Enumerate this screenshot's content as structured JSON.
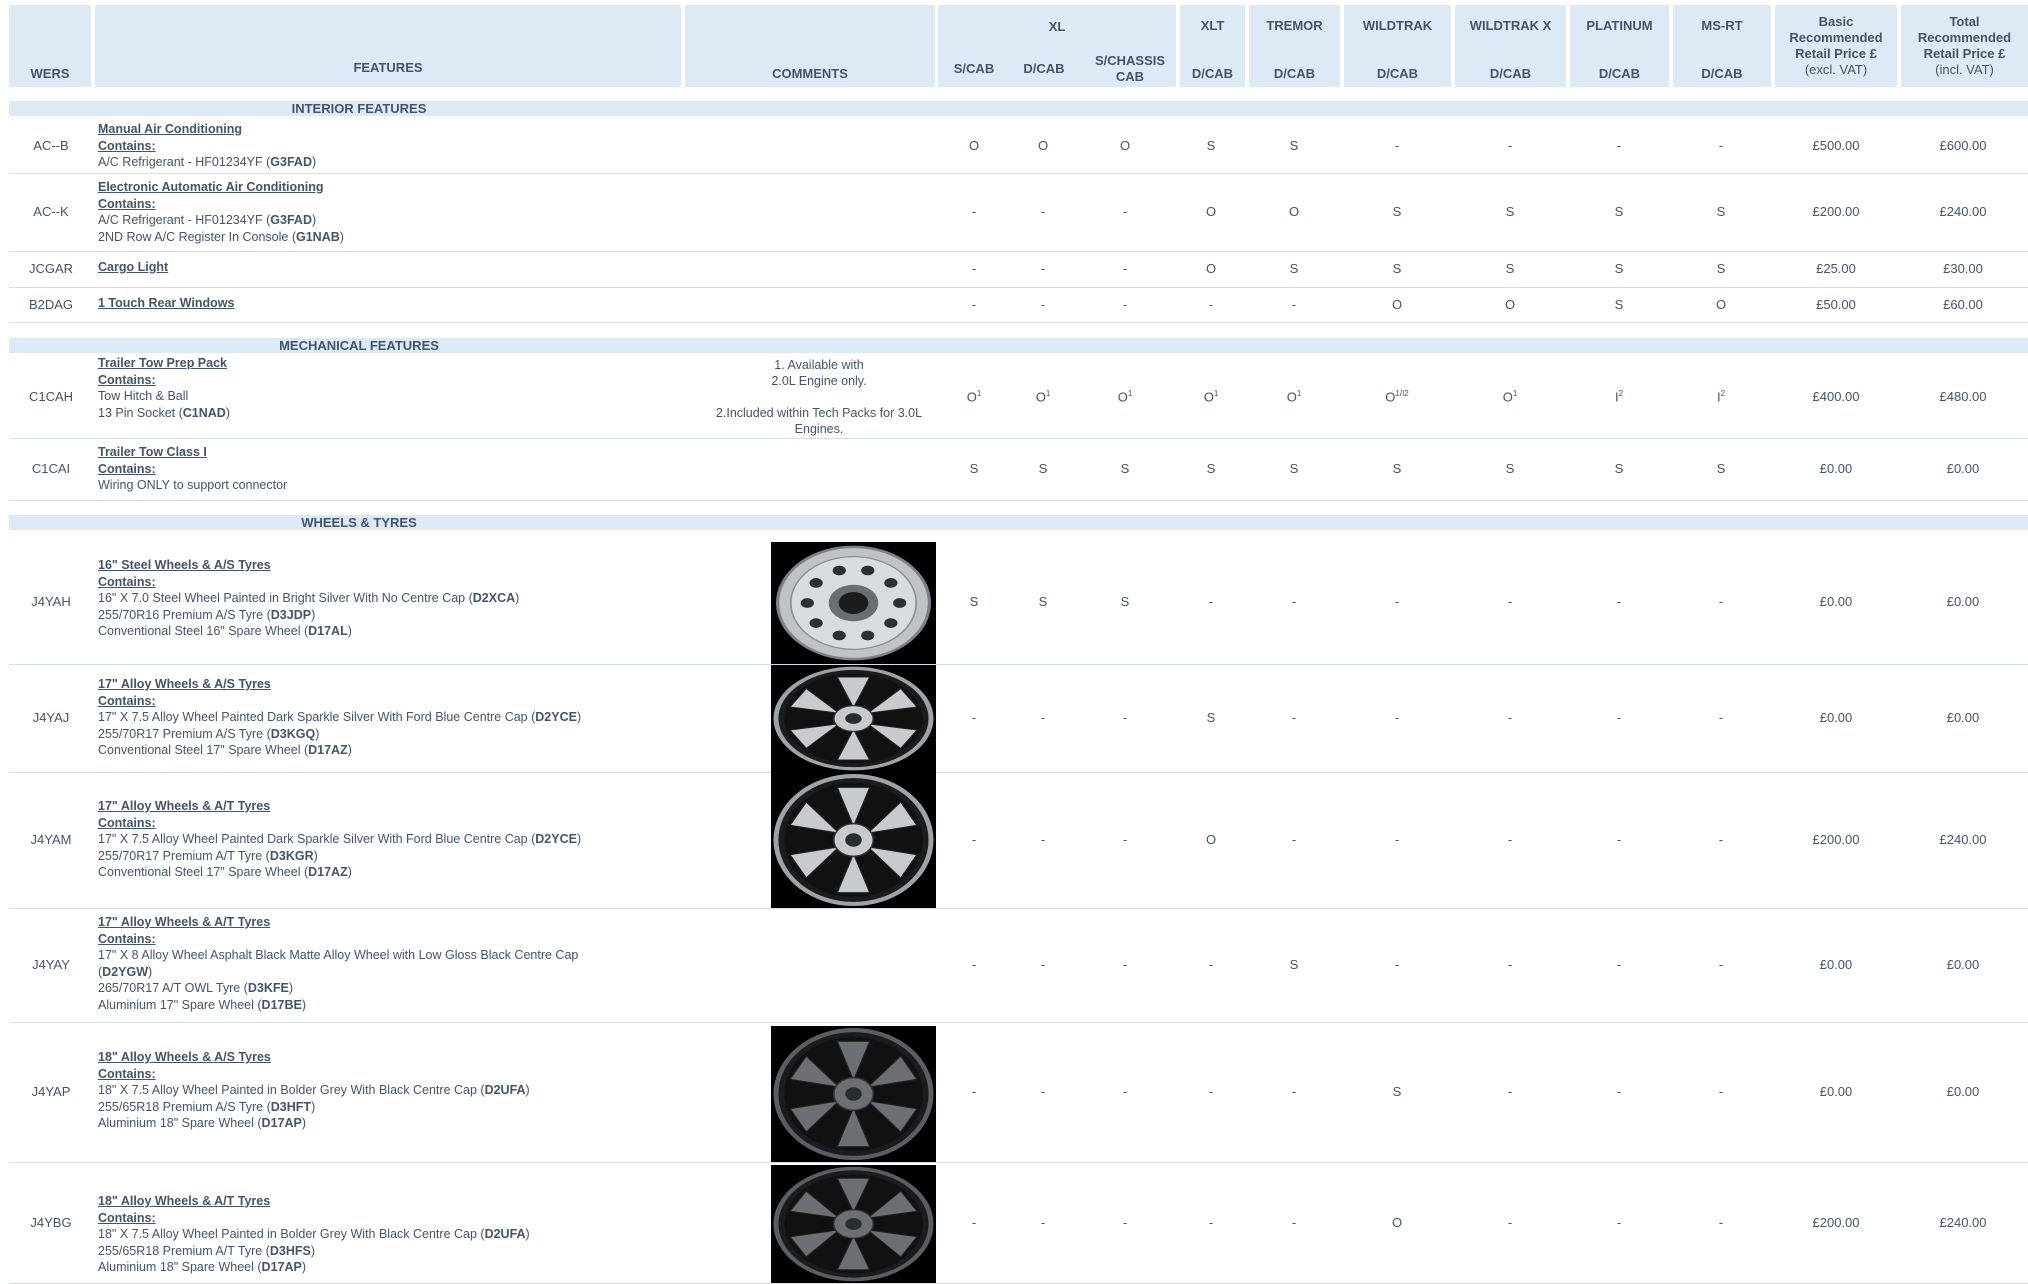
{
  "header": {
    "wers": "WERS",
    "features": "FEATURES",
    "comments": "COMMENTS",
    "xl": "XL",
    "xl_scab": "S/CAB",
    "xl_dcab": "D/CAB",
    "xl_schassis": "S/CHASSIS CAB",
    "xlt": "XLT",
    "tremor": "TREMOR",
    "wildtrak": "WILDTRAK",
    "wildtrakx": "WILDTRAK X",
    "platinum": "PLATINUM",
    "msrt": "MS-RT",
    "dcab": "D/CAB",
    "basic_title": "Basic Recommended Retail Price £",
    "basic_sub": "(excl. VAT)",
    "total_title": "Total Recommended Retail Price £",
    "total_sub": "(incl. VAT)"
  },
  "sections": {
    "interior": "INTERIOR FEATURES",
    "mechanical": "MECHANICAL FEATURES",
    "wheels": "WHEELS & TYRES"
  },
  "rows": [
    {
      "wers": "AC--B",
      "title": "Manual Air Conditioning",
      "contains": "Contains:",
      "lines": [
        [
          "A/C Refrigerant - HF01234YF (",
          "G3FAD",
          ")"
        ]
      ],
      "cells": [
        "O",
        "O",
        "O",
        "S",
        "S",
        "-",
        "-",
        "-",
        "-"
      ],
      "basic": "£500.00",
      "total": "£600.00"
    },
    {
      "wers": "AC--K",
      "title": "Electronic Automatic Air Conditioning",
      "contains": "Contains:",
      "lines": [
        [
          "A/C Refrigerant - HF01234YF (",
          "G3FAD",
          ")"
        ],
        [
          "2ND Row A/C Register In Console (",
          "G1NAB",
          ")"
        ]
      ],
      "cells": [
        "-",
        "-",
        "-",
        "O",
        "O",
        "S",
        "S",
        "S",
        "S"
      ],
      "basic": "£200.00",
      "total": "£240.00"
    },
    {
      "wers": "JCGAR",
      "title": "Cargo Light",
      "contains": "",
      "lines": [],
      "cells": [
        "-",
        "-",
        "-",
        "O",
        "S",
        "S",
        "S",
        "S",
        "S"
      ],
      "basic": "£25.00",
      "total": "£30.00"
    },
    {
      "wers": "B2DAG",
      "title": "1 Touch Rear Windows",
      "contains": "",
      "lines": [],
      "cells": [
        "-",
        "-",
        "-",
        "-",
        "-",
        "O",
        "O",
        "S",
        "O"
      ],
      "basic": "£50.00",
      "total": "£60.00"
    },
    {
      "wers": "C1CAH",
      "title": "Trailer Tow Prep Pack",
      "contains": "Contains:",
      "lines": [
        [
          "Tow Hitch & Ball",
          "",
          ""
        ],
        [
          "13 Pin Socket (",
          "C1NAD",
          ")"
        ]
      ],
      "comment1": "1. Available with",
      "comment2": "2.0L Engine only.",
      "comment3": "2.Included within Tech Packs for 3.0L",
      "comment4": "Engines.",
      "cells": [
        "O",
        "O",
        "O",
        "O",
        "O",
        "O",
        "O",
        "I",
        "I"
      ],
      "sups": [
        "1",
        "1",
        "1",
        "1",
        "1",
        "1/I2",
        "1",
        "2",
        "2"
      ],
      "basic": "£400.00",
      "total": "£480.00"
    },
    {
      "wers": "C1CAI",
      "title": "Trailer Tow Class I",
      "contains": "Contains:",
      "lines": [
        [
          "Wiring ONLY to support connector",
          "",
          ""
        ]
      ],
      "cells": [
        "S",
        "S",
        "S",
        "S",
        "S",
        "S",
        "S",
        "S",
        "S"
      ],
      "basic": "£0.00",
      "total": "£0.00"
    },
    {
      "wers": "J4YAH",
      "title": "16\" Steel Wheels & A/S Tyres",
      "contains": "Contains:",
      "lines": [
        [
          "16\" X 7.0 Steel Wheel  Painted in Bright Silver With No Centre Cap (",
          "D2XCA",
          ")"
        ],
        [
          "255/70R16 Premium A/S Tyre (",
          "D3JDP",
          ")"
        ],
        [
          "Conventional Steel 16\" Spare Wheel (",
          "D17AL",
          ")"
        ]
      ],
      "cells": [
        "S",
        "S",
        "S",
        "-",
        "-",
        "-",
        "-",
        "-",
        "-"
      ],
      "basic": "£0.00",
      "total": "£0.00"
    },
    {
      "wers": "J4YAJ",
      "title": "17\" Alloy Wheels & A/S Tyres",
      "contains": "Contains:",
      "lines": [
        [
          "17\" X 7.5 Alloy Wheel Painted Dark Sparkle Silver With Ford Blue Centre Cap (",
          "D2YCE",
          ")"
        ],
        [
          "255/70R17 Premium A/S Tyre (",
          "D3KGQ",
          ")"
        ],
        [
          "Conventional Steel 17\" Spare Wheel (",
          "D17AZ",
          ")"
        ]
      ],
      "cells": [
        "-",
        "-",
        "-",
        "S",
        "-",
        "-",
        "-",
        "-",
        "-"
      ],
      "basic": "£0.00",
      "total": "£0.00"
    },
    {
      "wers": "J4YAM",
      "title": "17\" Alloy Wheels & A/T Tyres",
      "contains": "Contains:",
      "lines": [
        [
          "17\" X 7.5 Alloy Wheel Painted Dark Sparkle Silver With Ford Blue Centre Cap (",
          "D2YCE",
          ")"
        ],
        [
          "255/70R17 Premium A/T Tyre (",
          "D3KGR",
          ")"
        ],
        [
          "Conventional Steel 17\" Spare Wheel (",
          "D17AZ",
          ")"
        ]
      ],
      "cells": [
        "-",
        "-",
        "-",
        "O",
        "-",
        "-",
        "-",
        "-",
        "-"
      ],
      "basic": "£200.00",
      "total": "£240.00"
    },
    {
      "wers": "J4YAY",
      "title": "17\" Alloy Wheels & A/T Tyres",
      "contains": "Contains:",
      "lines": [
        [
          "17\" X 8 Alloy Wheel Asphalt Black Matte Alloy Wheel with Low Gloss Black Centre Cap",
          "",
          ""
        ],
        [
          "(",
          "D2YGW",
          ")"
        ],
        [
          "265/70R17 A/T OWL Tyre (",
          "D3KFE",
          ")"
        ],
        [
          "Aluminium 17\" Spare Wheel (",
          "D17BE",
          ")"
        ]
      ],
      "cells": [
        "-",
        "-",
        "-",
        "-",
        "S",
        "-",
        "-",
        "-",
        "-"
      ],
      "basic": "£0.00",
      "total": "£0.00"
    },
    {
      "wers": "J4YAP",
      "title": "18\" Alloy Wheels & A/S Tyres",
      "contains": "Contains:",
      "lines": [
        [
          "18\" X 7.5 Alloy Wheel Painted in Bolder Grey With Black Centre Cap  (",
          "D2UFA",
          ")"
        ],
        [
          "255/65R18 Premium A/S Tyre (",
          "D3HFT",
          ")"
        ],
        [
          "Aluminium 18\" Spare Wheel (",
          "D17AP",
          ")"
        ]
      ],
      "cells": [
        "-",
        "-",
        "-",
        "-",
        "-",
        "S",
        "-",
        "-",
        "-"
      ],
      "basic": "£0.00",
      "total": "£0.00"
    },
    {
      "wers": "J4YBG",
      "title": "18\" Alloy Wheels & A/T Tyres",
      "contains": "Contains:",
      "lines": [
        [
          "18\" X 7.5 Alloy Wheel Painted in Bolder Grey With Black Centre Cap (",
          "D2UFA",
          ")"
        ],
        [
          "255/65R18 Premium A/T Tyre (",
          "D3HFS",
          ")"
        ],
        [
          "Aluminium 18\" Spare Wheel (",
          "D17AP",
          ")"
        ]
      ],
      "cells": [
        "-",
        "-",
        "-",
        "-",
        "-",
        "O",
        "-",
        "-",
        "-"
      ],
      "basic": "£200.00",
      "total": "£240.00"
    }
  ],
  "wheel_images": [
    "steel-wheel-16",
    "alloy-wheel-17-silver",
    "alloy-wheel-17-silver",
    "alloy-wheel-18-grey",
    "alloy-wheel-18-grey"
  ]
}
